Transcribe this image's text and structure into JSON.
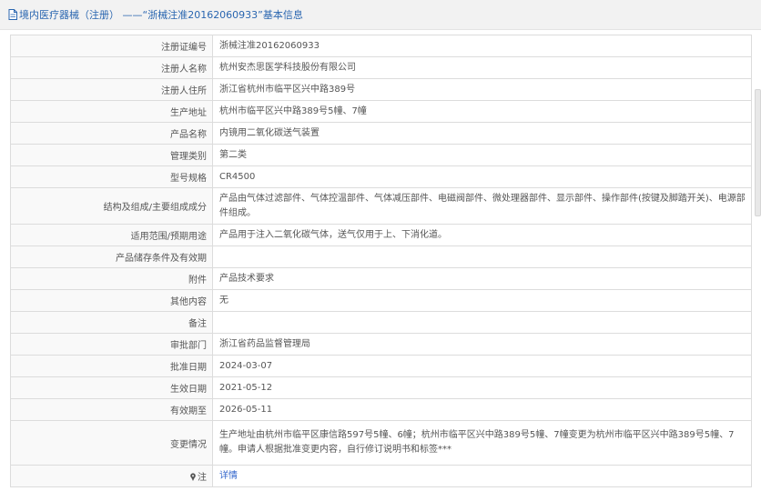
{
  "header": {
    "title": "境内医疗器械（注册） ——“浙械注准20162060933”基本信息",
    "icon": "document-icon",
    "color": "#2a66b0"
  },
  "rows": [
    {
      "label": "注册证编号",
      "value": "浙械注准20162060933"
    },
    {
      "label": "注册人名称",
      "value": "杭州安杰思医学科技股份有限公司"
    },
    {
      "label": "注册人住所",
      "value": "浙江省杭州市临平区兴中路389号"
    },
    {
      "label": "生产地址",
      "value": "杭州市临平区兴中路389号5幢、7幢"
    },
    {
      "label": "产品名称",
      "value": "内镜用二氧化碳送气装置"
    },
    {
      "label": "管理类别",
      "value": "第二类"
    },
    {
      "label": "型号规格",
      "value": "CR4500"
    },
    {
      "label": "结构及组成/主要组成成分",
      "value": "产品由气体过滤部件、气体控温部件、气体减压部件、电磁阀部件、微处理器部件、显示部件、操作部件(按键及脚踏开关)、电源部件组成。"
    },
    {
      "label": "适用范围/预期用途",
      "value": "产品用于注入二氧化碳气体，送气仅用于上、下消化道。"
    },
    {
      "label": "产品储存条件及有效期",
      "value": ""
    },
    {
      "label": "附件",
      "value": "产品技术要求"
    },
    {
      "label": "其他内容",
      "value": "无"
    },
    {
      "label": "备注",
      "value": ""
    },
    {
      "label": "审批部门",
      "value": "浙江省药品监督管理局"
    },
    {
      "label": "批准日期",
      "value": "2024-03-07"
    },
    {
      "label": "生效日期",
      "value": "2021-05-12"
    },
    {
      "label": "有效期至",
      "value": "2026-05-11"
    },
    {
      "label": "变更情况",
      "value": "生产地址由杭州市临平区康信路597号5幢、6幢；杭州市临平区兴中路389号5幢、7幢变更为杭州市临平区兴中路389号5幢、7幢。申请人根据批准变更内容，自行修订说明书和标签***"
    }
  ],
  "note": {
    "label": "注",
    "icon": "pin-icon",
    "link_text": "详情"
  }
}
